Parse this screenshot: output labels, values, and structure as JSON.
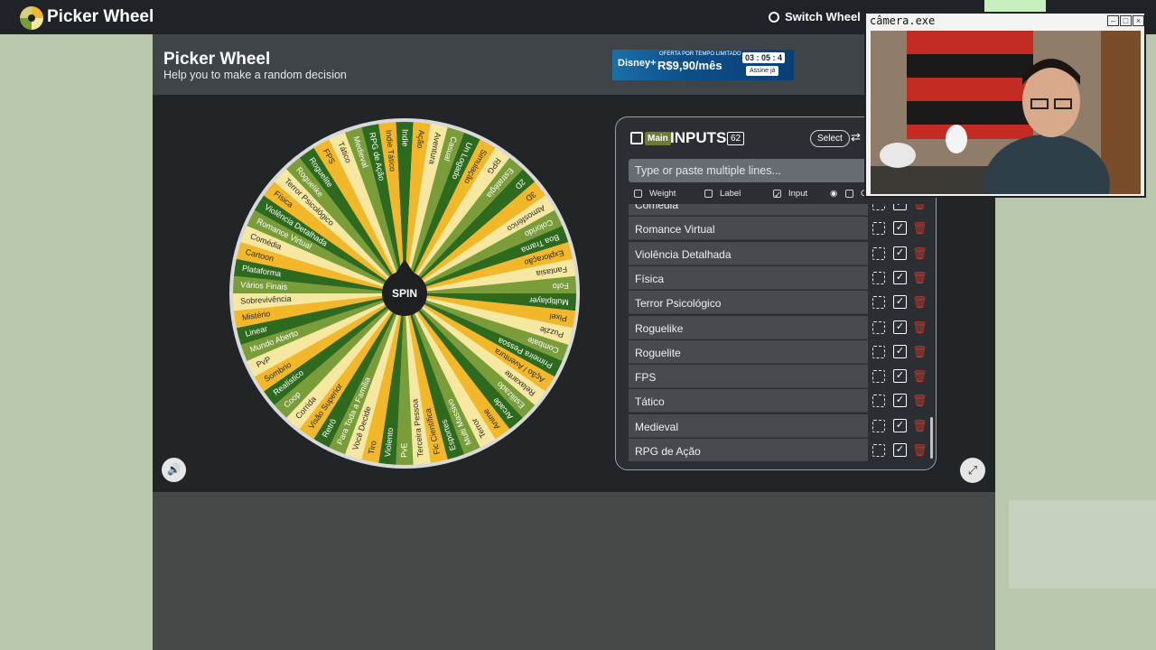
{
  "nav": {
    "brand": "Picker Wheel",
    "switch_label": "Switch Wheel"
  },
  "header": {
    "title": "Picker Wheel",
    "subtitle": "Help you to make a random decision"
  },
  "ad": {
    "offer": "OFERTA POR TEMPO LIMITADO",
    "brand": "Disney+",
    "price": "R$9,90/mês",
    "countdown": "03 : 05 : 4",
    "cta": "Assine já"
  },
  "wheel": {
    "spin_label": "SPIN",
    "slices": [
      "Indie",
      "Ação",
      "Aventura",
      "Casual",
      "Un Logado",
      "Simulação",
      "RPG",
      "Estratégia",
      "2D",
      "3D",
      "Atmosférico",
      "Colorido",
      "Boa Trama",
      "Exploração",
      "Fantasia",
      "Fofo",
      "Multiplayer",
      "Pixel",
      "Puzzle",
      "Combate",
      "Primeira Pessoa",
      "Ação / Aventura",
      "Relaxante",
      "Estilizado",
      "Arcade",
      "Anime",
      "Terror",
      "Multi Massivo",
      "Esportes",
      "Fic Científica",
      "Terceira Pessoa",
      "PvE",
      "Violento",
      "Tiro",
      "Você Decide",
      "Para Toda a Família",
      "Retrô",
      "Visão Superior",
      "Corrida",
      "Coop",
      "Realístico",
      "Sombrio",
      "PvP",
      "Mundo Aberto",
      "Linear",
      "Mistério",
      "Sobrevivência",
      "Vários Finais",
      "Plataforma",
      "Cartoon",
      "Comédia",
      "Romance Virtual",
      "Violência Detalhada",
      "Física",
      "Terror Psicológico",
      "Roguelike",
      "Roguelite",
      "FPS",
      "Tático",
      "Medieval",
      "RPG de Ação",
      "Indie Tático"
    ],
    "colors": [
      "#2e6a1e",
      "#f2b82a",
      "#f7e8a1",
      "#7a9d3a"
    ],
    "label_colors": [
      "#ffffff",
      "#2a2a2a",
      "#2a2a2a",
      "#ffffff"
    ]
  },
  "inputs": {
    "tag": "Main",
    "title": "INPUTS",
    "count": "62",
    "select_label": "Select",
    "placeholder": "Type or paste multiple lines...",
    "columns": {
      "weight": "Weight",
      "label": "Label",
      "input": "Input",
      "color": "Color"
    },
    "rows": [
      "Comédia",
      "Romance Virtual",
      "Violência Detalhada",
      "Física",
      "Terror Psicológico",
      "Roguelike",
      "Roguelite",
      "FPS",
      "Tático",
      "Medieval",
      "RPG de Ação"
    ]
  },
  "cam": {
    "title": "câmera.exe"
  }
}
